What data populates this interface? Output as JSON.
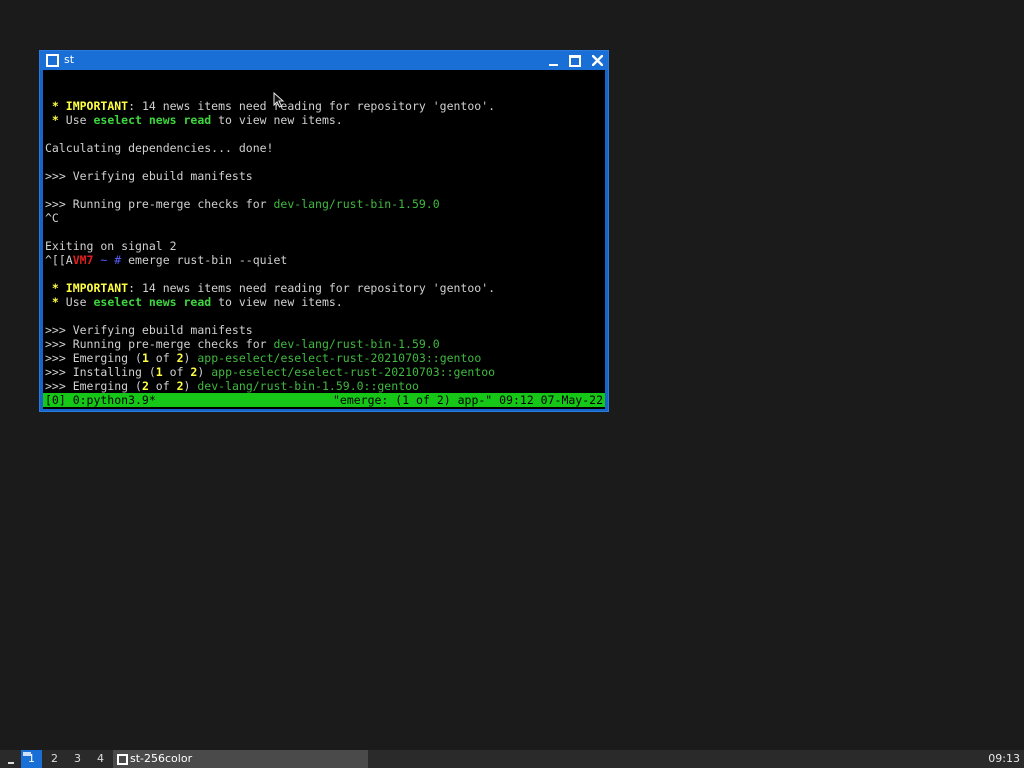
{
  "window": {
    "title": "st",
    "icons": {
      "window": "window-icon",
      "minimize": "minimize-icon",
      "maximize": "maximize-icon",
      "close": "close-icon"
    }
  },
  "terminal": {
    "lines": [
      [],
      [
        {
          "t": " * ",
          "c": "c-yellowb"
        },
        {
          "t": "IMPORTANT",
          "c": "c-yellowb"
        },
        {
          "t": ": 14 news items need reading for repository 'gentoo'."
        }
      ],
      [
        {
          "t": " * ",
          "c": "c-yellowb"
        },
        {
          "t": "Use "
        },
        {
          "t": "eselect news read",
          "c": "c-greenb"
        },
        {
          "t": " to view new items."
        }
      ],
      [],
      [
        {
          "t": "Calculating dependencies... done!"
        }
      ],
      [],
      [
        {
          "t": ">>> Verifying ebuild manifests"
        }
      ],
      [],
      [
        {
          "t": ">>> Running pre-merge checks for "
        },
        {
          "t": "dev-lang/rust-bin-1.59.0",
          "c": "c-green"
        }
      ],
      [
        {
          "t": "^C"
        }
      ],
      [],
      [
        {
          "t": "Exiting on signal 2"
        }
      ],
      [
        {
          "t": "^[[A"
        },
        {
          "t": "VM7",
          "c": "c-red"
        },
        {
          "t": " ~ # ",
          "c": "c-blue"
        },
        {
          "t": "emerge rust-bin --quiet"
        }
      ],
      [],
      [
        {
          "t": " * ",
          "c": "c-yellowb"
        },
        {
          "t": "IMPORTANT",
          "c": "c-yellowb"
        },
        {
          "t": ": 14 news items need reading for repository 'gentoo'."
        }
      ],
      [
        {
          "t": " * ",
          "c": "c-yellowb"
        },
        {
          "t": "Use "
        },
        {
          "t": "eselect news read",
          "c": "c-greenb"
        },
        {
          "t": " to view new items."
        }
      ],
      [],
      [
        {
          "t": ">>> Verifying ebuild manifests"
        }
      ],
      [
        {
          "t": ">>> Running pre-merge checks for "
        },
        {
          "t": "dev-lang/rust-bin-1.59.0",
          "c": "c-green"
        }
      ],
      [
        {
          "t": ">>> Emerging ("
        },
        {
          "t": "1",
          "c": "c-yellowb"
        },
        {
          "t": " of "
        },
        {
          "t": "2",
          "c": "c-yellowb"
        },
        {
          "t": ") "
        },
        {
          "t": "app-eselect/eselect-rust-20210703::gentoo",
          "c": "c-green"
        }
      ],
      [
        {
          "t": ">>> Installing ("
        },
        {
          "t": "1",
          "c": "c-yellowb"
        },
        {
          "t": " of "
        },
        {
          "t": "2",
          "c": "c-yellowb"
        },
        {
          "t": ") "
        },
        {
          "t": "app-eselect/eselect-rust-20210703::gentoo",
          "c": "c-green"
        }
      ],
      [
        {
          "t": ">>> Emerging ("
        },
        {
          "t": "2",
          "c": "c-yellowb"
        },
        {
          "t": " of "
        },
        {
          "t": "2",
          "c": "c-yellowb"
        },
        {
          "t": ") "
        },
        {
          "t": "dev-lang/rust-bin-1.59.0::gentoo",
          "c": "c-green"
        }
      ],
      [
        {
          "cursor": true
        }
      ]
    ]
  },
  "tmux": {
    "left": "[0] 0:python3.9*",
    "right": "\"emerge: (1 of 2) app-\" 09:12 07-May-22"
  },
  "taskbar": {
    "workspaces": [
      "1",
      "2",
      "3",
      "4"
    ],
    "active_workspace": "1",
    "task_label": "st-256color",
    "clock": "09:13"
  },
  "colors": {
    "desktop": "#1b1b1b",
    "window_border": "#1a6fd6",
    "tmux_status": "#17c717",
    "taskbar": "#2a2a2a"
  }
}
